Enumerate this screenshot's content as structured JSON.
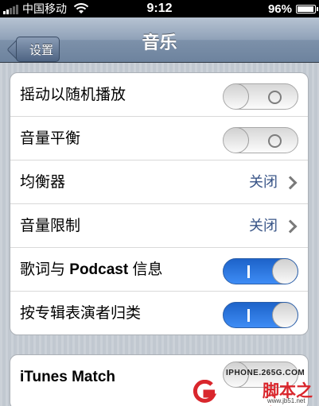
{
  "status_bar": {
    "carrier": "中国移动",
    "time": "9:12",
    "battery": "96%",
    "battery_level": 0.96
  },
  "nav_bar": {
    "back_label": "设置",
    "title": "音乐"
  },
  "settings": [
    {
      "label": "摇动以随机播放",
      "control": "toggle",
      "state": "off"
    },
    {
      "label": "音量平衡",
      "control": "toggle",
      "state": "off"
    },
    {
      "label": "均衡器",
      "control": "disclosure",
      "value": "关闭"
    },
    {
      "label": "音量限制",
      "control": "disclosure",
      "value": "关闭"
    },
    {
      "label_prefix": "歌词与 ",
      "label_bold": "Podcast",
      "label_suffix": " 信息",
      "control": "toggle",
      "state": "on"
    },
    {
      "label": "按专辑表演者归类",
      "control": "toggle",
      "state": "on"
    }
  ],
  "itunes_match": {
    "label": "iTunes Match"
  },
  "watermark": {
    "site": "IPHONE.265G.COM",
    "brand": "脚本之家",
    "url": "www.jb51.net"
  }
}
